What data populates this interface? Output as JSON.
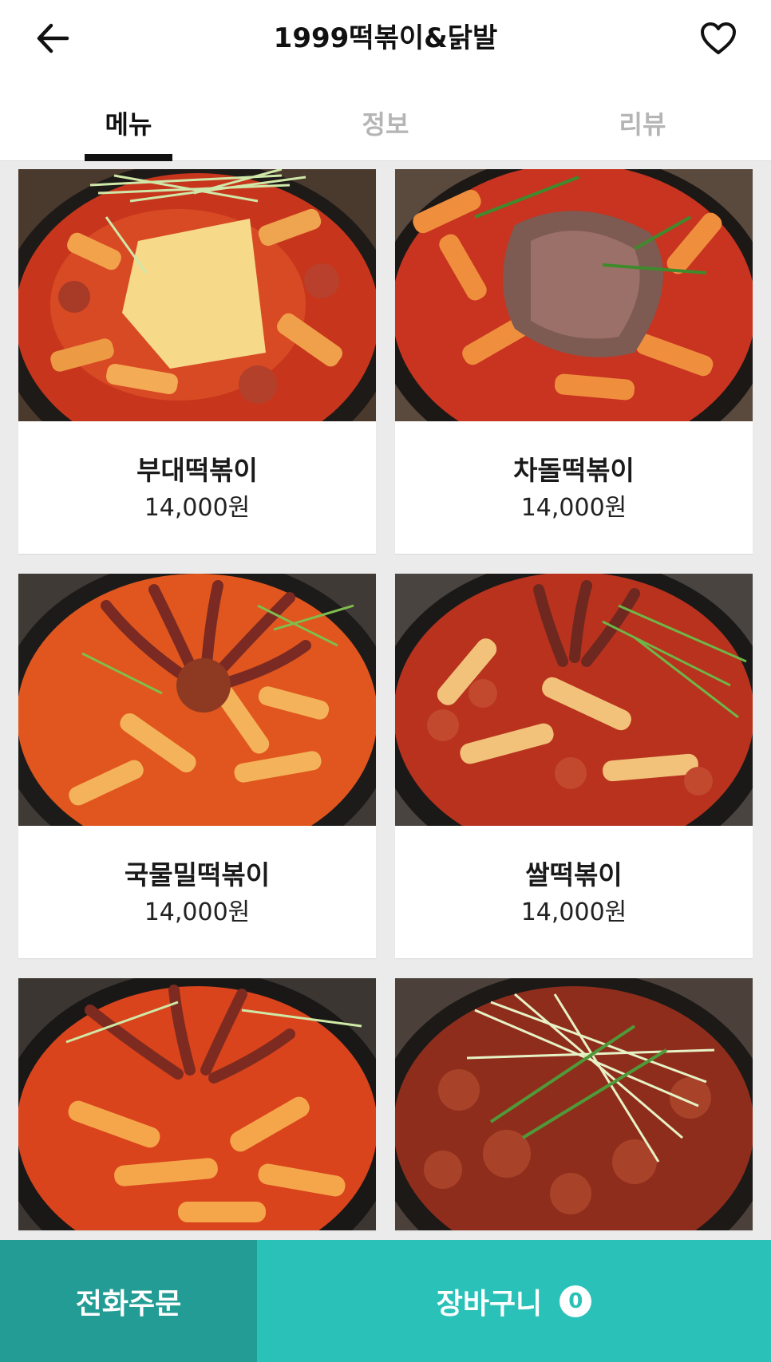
{
  "header": {
    "title": "1999떡볶이&닭발",
    "back_icon": "arrow-left-icon",
    "favorite_icon": "heart-outline-icon"
  },
  "tabs": [
    {
      "label": "메뉴",
      "active": true
    },
    {
      "label": "정보",
      "active": false
    },
    {
      "label": "리뷰",
      "active": false
    }
  ],
  "menu_items": [
    {
      "name": "부대떡볶이",
      "price": "14,000원"
    },
    {
      "name": "차돌떡볶이",
      "price": "14,000원"
    },
    {
      "name": "국물밀떡볶이",
      "price": "14,000원"
    },
    {
      "name": "쌀떡볶이",
      "price": "14,000원"
    }
  ],
  "bottom_bar": {
    "phone_order_label": "전화주문",
    "cart_label": "장바구니",
    "cart_count": "0"
  },
  "colors": {
    "accent": "#2ac1b8",
    "accent_dark": "#229c94"
  }
}
